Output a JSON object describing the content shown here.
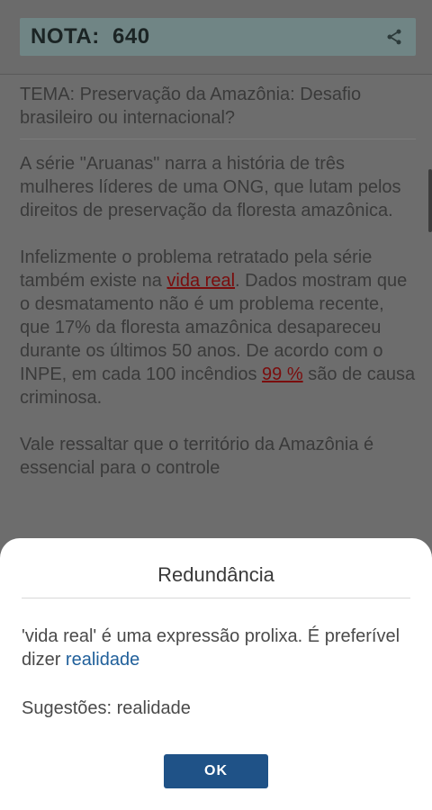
{
  "header": {
    "score_label": "NOTA:",
    "score_value": "640",
    "share_icon": "share-icon"
  },
  "essay": {
    "theme": "TEMA: Preservação da Amazônia: Desafio brasileiro ou internacional?",
    "p1": "A série \"Aruanas\" narra a história de três mulheres líderes de uma ONG, que lutam pelos direitos de preservação da floresta amazônica.",
    "p2_before": "Infelizmente o problema retratado pela série também existe na ",
    "p2_err1": "vida real",
    "p2_mid": ". Dados mostram que o desmatamento não é um problema recente, que 17% da floresta amazônica desapareceu durante os últimos 50 anos. De acordo com o INPE, em cada 100 incêndios ",
    "p2_err2": "99 %",
    "p2_after": " são de causa criminosa.",
    "p3": "Vale ressaltar que o território da Amazônia é essencial para o controle"
  },
  "dialog": {
    "title": "Redundância",
    "message_before": "'vida real' é uma expressão prolixa. É preferível dizer ",
    "message_link": "realidade",
    "suggestions": "Sugestões: realidade",
    "ok_label": "OK"
  },
  "colors": {
    "dialog_button": "#1f5287",
    "link": "#1f5f9a",
    "error": "#7a0d0d"
  }
}
